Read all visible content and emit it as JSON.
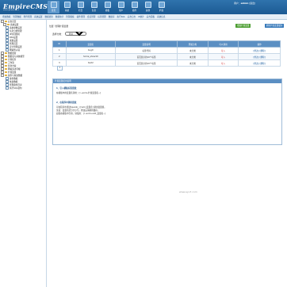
{
  "header": {
    "logo": "EmpireCMS",
    "logo_sub": "www.phome.net",
    "nav": [
      {
        "label": "首页",
        "icon": "home-icon",
        "active": true
      },
      {
        "label": "系统",
        "icon": "system-icon"
      },
      {
        "label": "栏目",
        "icon": "column-icon"
      },
      {
        "label": "信息",
        "icon": "info-icon"
      },
      {
        "label": "模板",
        "icon": "template-icon"
      },
      {
        "label": "用户",
        "icon": "user-icon"
      },
      {
        "label": "插件",
        "icon": "plugin-icon"
      },
      {
        "label": "其他",
        "icon": "other-icon"
      },
      {
        "label": "扩展",
        "icon": "extend-icon"
      }
    ],
    "user_text": "用户：",
    "username": "admin",
    "logout": "[退出]"
  },
  "submenu": [
    "增加数据",
    "管理数据",
    "附件管理",
    "系统设置",
    "数据更新",
    "数据统计",
    "管理模板",
    "插件管理",
    "会员管理",
    "标签管理",
    "数据库",
    "执行SQL",
    "后台日志",
    "IP统计",
    "后台面板",
    "系统信息"
  ],
  "tree": [
    {
      "label": "后台首页",
      "indent": 0,
      "type": "fld"
    },
    {
      "label": "系统设置",
      "indent": 1,
      "type": "fld"
    },
    {
      "label": "系统参数设置",
      "indent": 2,
      "type": "doc"
    },
    {
      "label": "信息分类管理",
      "indent": 2,
      "type": "doc"
    },
    {
      "label": "IP访问限制",
      "indent": 2,
      "type": "doc"
    },
    {
      "label": "RSS设置",
      "indent": 2,
      "type": "doc"
    },
    {
      "label": "采集设置",
      "indent": 2,
      "type": "doc"
    },
    {
      "label": "管理首页",
      "indent": 2,
      "type": "doc"
    },
    {
      "label": "安全管理设置",
      "indent": 2,
      "type": "doc"
    },
    {
      "label": "网站防火墙",
      "indent": 2,
      "type": "doc"
    },
    {
      "label": "数据更新",
      "indent": 0,
      "type": "fld"
    },
    {
      "label": "数据表与系统模型",
      "indent": 0,
      "type": "fld"
    },
    {
      "label": "计划任务",
      "indent": 0,
      "type": "fld"
    },
    {
      "label": "工作流",
      "indent": 0,
      "type": "fld"
    },
    {
      "label": "优化方案",
      "indent": 0,
      "type": "fld"
    },
    {
      "label": "网站多访问端",
      "indent": 0,
      "type": "fld"
    },
    {
      "label": "扩展变量",
      "indent": 0,
      "type": "fld"
    },
    {
      "label": "备份与恢复数据",
      "indent": 0,
      "type": "fld"
    },
    {
      "label": "备份数据",
      "indent": 2,
      "type": "doc"
    },
    {
      "label": "恢复数据",
      "indent": 2,
      "type": "doc"
    },
    {
      "label": "管理备份目录",
      "indent": 2,
      "type": "doc"
    },
    {
      "label": "执行SQL语句",
      "indent": 2,
      "type": "doc"
    }
  ],
  "main": {
    "breadcrumb": "位置: 管理扩展变量",
    "btn_add": "增加扩展变量",
    "btn_refresh": "刷新扩展变量缓存",
    "filter_label": "选择分类：",
    "filter_value": "显示所有分类",
    "columns": [
      "ID",
      "变量名",
      "变量说明",
      "所属分类",
      "可以调用",
      "操作"
    ],
    "rows": [
      {
        "id": "1",
        "name": "bugit",
        "desc": "标签代码",
        "cat": "未分类",
        "call": "可入",
        "op": "[修改] [删除]"
      },
      {
        "id": "2",
        "name": "home_show10",
        "desc": "首页显示的10个标签",
        "cat": "未分类",
        "call": "可入",
        "op": "[修改] [删除]"
      },
      {
        "id": "3",
        "name": "text2",
        "desc": "首页显示的10个标签",
        "cat": "未分类",
        "call": "可入",
        "op": "[修改] [删除]"
      }
    ],
    "pager": "1"
  },
  "help": {
    "title": "扩展变量使用说明",
    "s1": "1、引入模板标签变量：",
    "s1_text": "在模板中用变量名调用：[!--ecms.扩展变量名--]",
    "s2": "2、在程序中调用变量：",
    "s2_text1": "可在程序中通过$public_r['add_变量名']调用变量值。",
    "s2_text2": "注意：变量名区分大小写，修改后请刷新缓存。",
    "s2_text3": "如需在模板中引用，请使用：[!--ecms.add_变量名--]"
  },
  "watermark": "www.eyu7.com"
}
